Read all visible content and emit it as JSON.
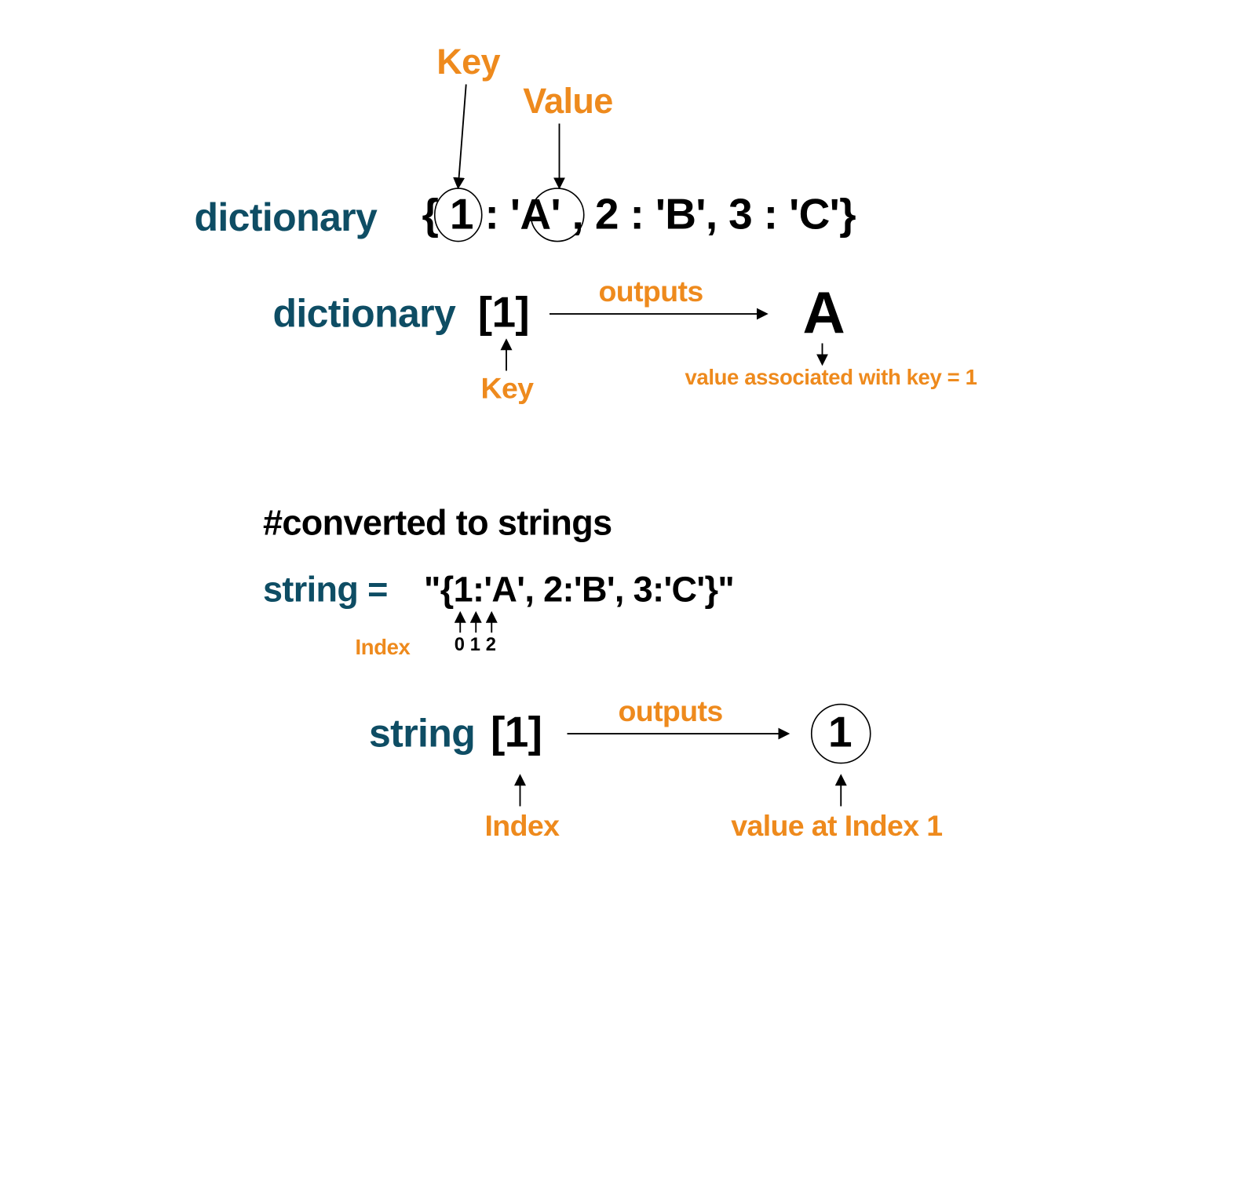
{
  "labels": {
    "key_top": "Key",
    "value_top": "Value",
    "dictionary": "dictionary",
    "dict_literal": "{  1  : 'A' , 2 : 'B', 3 : 'C'}",
    "dict_access_var": "dictionary",
    "dict_access_idx": "[1]",
    "outputs": "outputs",
    "output_A": "A",
    "key_below": "Key",
    "value_assoc": "value associated with key = 1",
    "comment": "#converted to strings",
    "string_var": "string =",
    "string_literal": "\"{1:'A', 2:'B', 3:'C'}\"",
    "index_label": "Index",
    "idx0": "0",
    "idx1": "1",
    "idx2": "2",
    "string_access_var": "string",
    "string_access_idx": "[1]",
    "output_1": "1",
    "index_bottom": "Index",
    "value_at_index": "value at Index  1"
  },
  "colors": {
    "teal": "#0e4d64",
    "orange": "#ee8a1d",
    "black": "#000000"
  },
  "diagram_data": {
    "dictionary": {
      "1": "A",
      "2": "B",
      "3": "C"
    },
    "dictionary_access_key": 1,
    "dictionary_access_result": "A",
    "string_value": "{1:'A', 2:'B', 3:'C'}",
    "string_index_marks": [
      0,
      1,
      2
    ],
    "string_access_index": 1,
    "string_access_result": "1"
  }
}
